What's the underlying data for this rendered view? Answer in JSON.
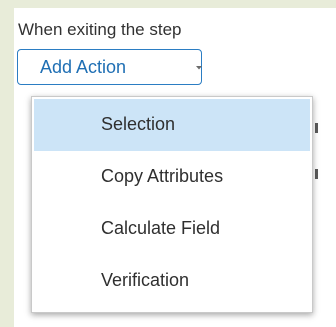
{
  "section": {
    "label": "When exiting the step"
  },
  "add_action": {
    "label": "Add Action",
    "icon": "chevron-down-icon"
  },
  "menu": {
    "items": [
      {
        "label": "Selection",
        "selected": true
      },
      {
        "label": "Copy Attributes",
        "selected": false
      },
      {
        "label": "Calculate Field",
        "selected": false
      },
      {
        "label": "Verification",
        "selected": false
      }
    ]
  },
  "colors": {
    "background": "#e8ecd9",
    "accent": "#2b7dc3",
    "accent_text": "#1f6fb4",
    "selected_item": "#cce4f7",
    "text": "#2f2f2f"
  }
}
